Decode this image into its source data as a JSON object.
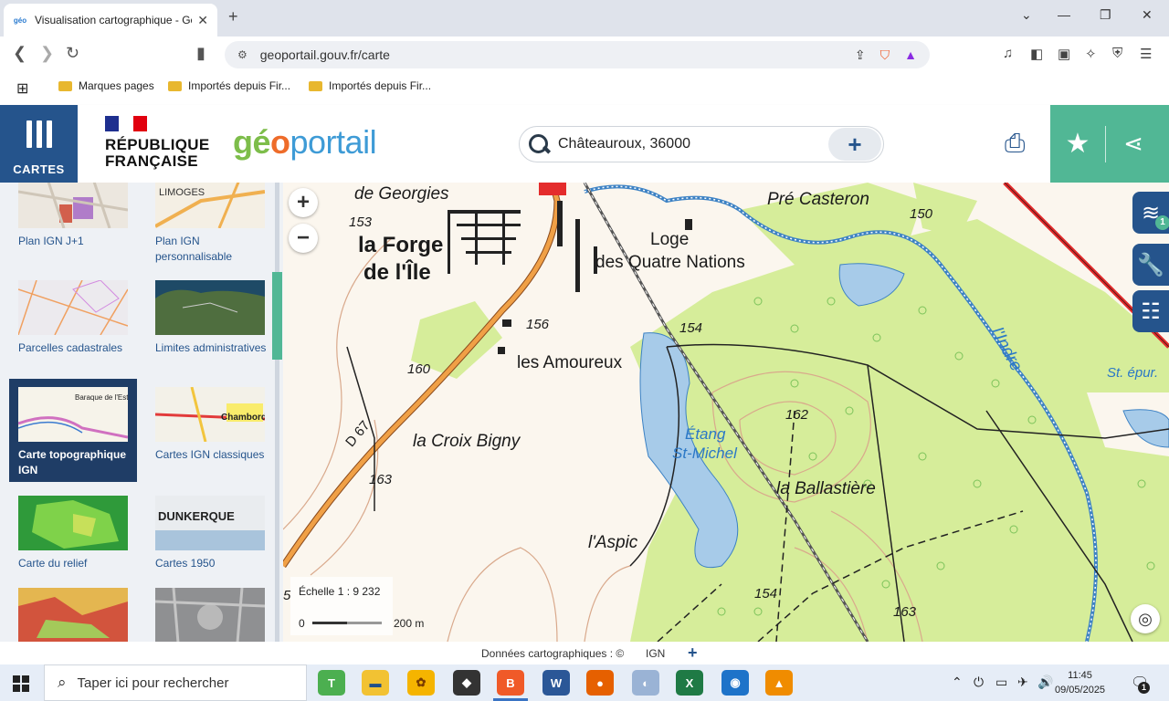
{
  "browser": {
    "tab_title": "Visualisation cartographique - Géoportail",
    "url": "geoportail.gouv.fr/carte",
    "bookmarks": [
      "Marques pages",
      "Importés depuis Fir...",
      "Importés depuis Fir..."
    ]
  },
  "header": {
    "cartes_label": "CARTES",
    "republique": [
      "RÉPUBLIQUE",
      "FRANÇAISE"
    ],
    "logo_geo": "gé",
    "logo_o": "o",
    "logo_portail": "portail",
    "search_value": "Châteauroux, 36000"
  },
  "catalog": {
    "items": [
      {
        "label": "Plan IGN J+1"
      },
      {
        "label": "Plan IGN personnalisable"
      },
      {
        "label": "Parcelles cadastrales"
      },
      {
        "label": "Limites administratives"
      },
      {
        "label": "Carte topographique IGN",
        "selected": true
      },
      {
        "label": "Cartes IGN classiques"
      },
      {
        "label": "Carte du relief"
      },
      {
        "label": "Cartes 1950"
      },
      {
        "label": ""
      },
      {
        "label": ""
      }
    ],
    "thumb_text": {
      "limoges": "LIMOGES",
      "baraque": "Baraque de l'Estrade",
      "chambord": "Chambord",
      "dunkerque": "DUNKERQUE"
    }
  },
  "map": {
    "labels": {
      "de_georgies": "de Georgies",
      "forge_1": "la Forge",
      "forge_2": "de l'Île",
      "loge_1": "Loge",
      "loge_2": "des Quatre Nations",
      "pre_casteron": "Pré Casteron",
      "amoureux": "les Amoureux",
      "croix_bigny": "la Croix Bigny",
      "aspic": "l'Aspic",
      "ballastiere": "la Ballastière",
      "etang_1": "Étang",
      "etang_2": "St-Michel",
      "indre": "l'Indre",
      "st_epur": "St. épur.",
      "d67": "D 67",
      "e153": "153",
      "e156": "156",
      "e160": "160",
      "e163a": "163",
      "e154a": "154",
      "e162": "162",
      "e154b": "154",
      "e163b": "163",
      "e150": "150",
      "e5": "5"
    },
    "scale": {
      "text": "Échelle 1 :  9 232",
      "zero": "0",
      "distance": "200 m"
    },
    "layers_count": "1"
  },
  "footer": {
    "credits": "Données cartographiques : ©",
    "ign": "IGN"
  },
  "taskbar": {
    "search_placeholder": "Taper ici pour rechercher",
    "time": "11:45",
    "date": "09/05/2025",
    "notifications": "1"
  }
}
